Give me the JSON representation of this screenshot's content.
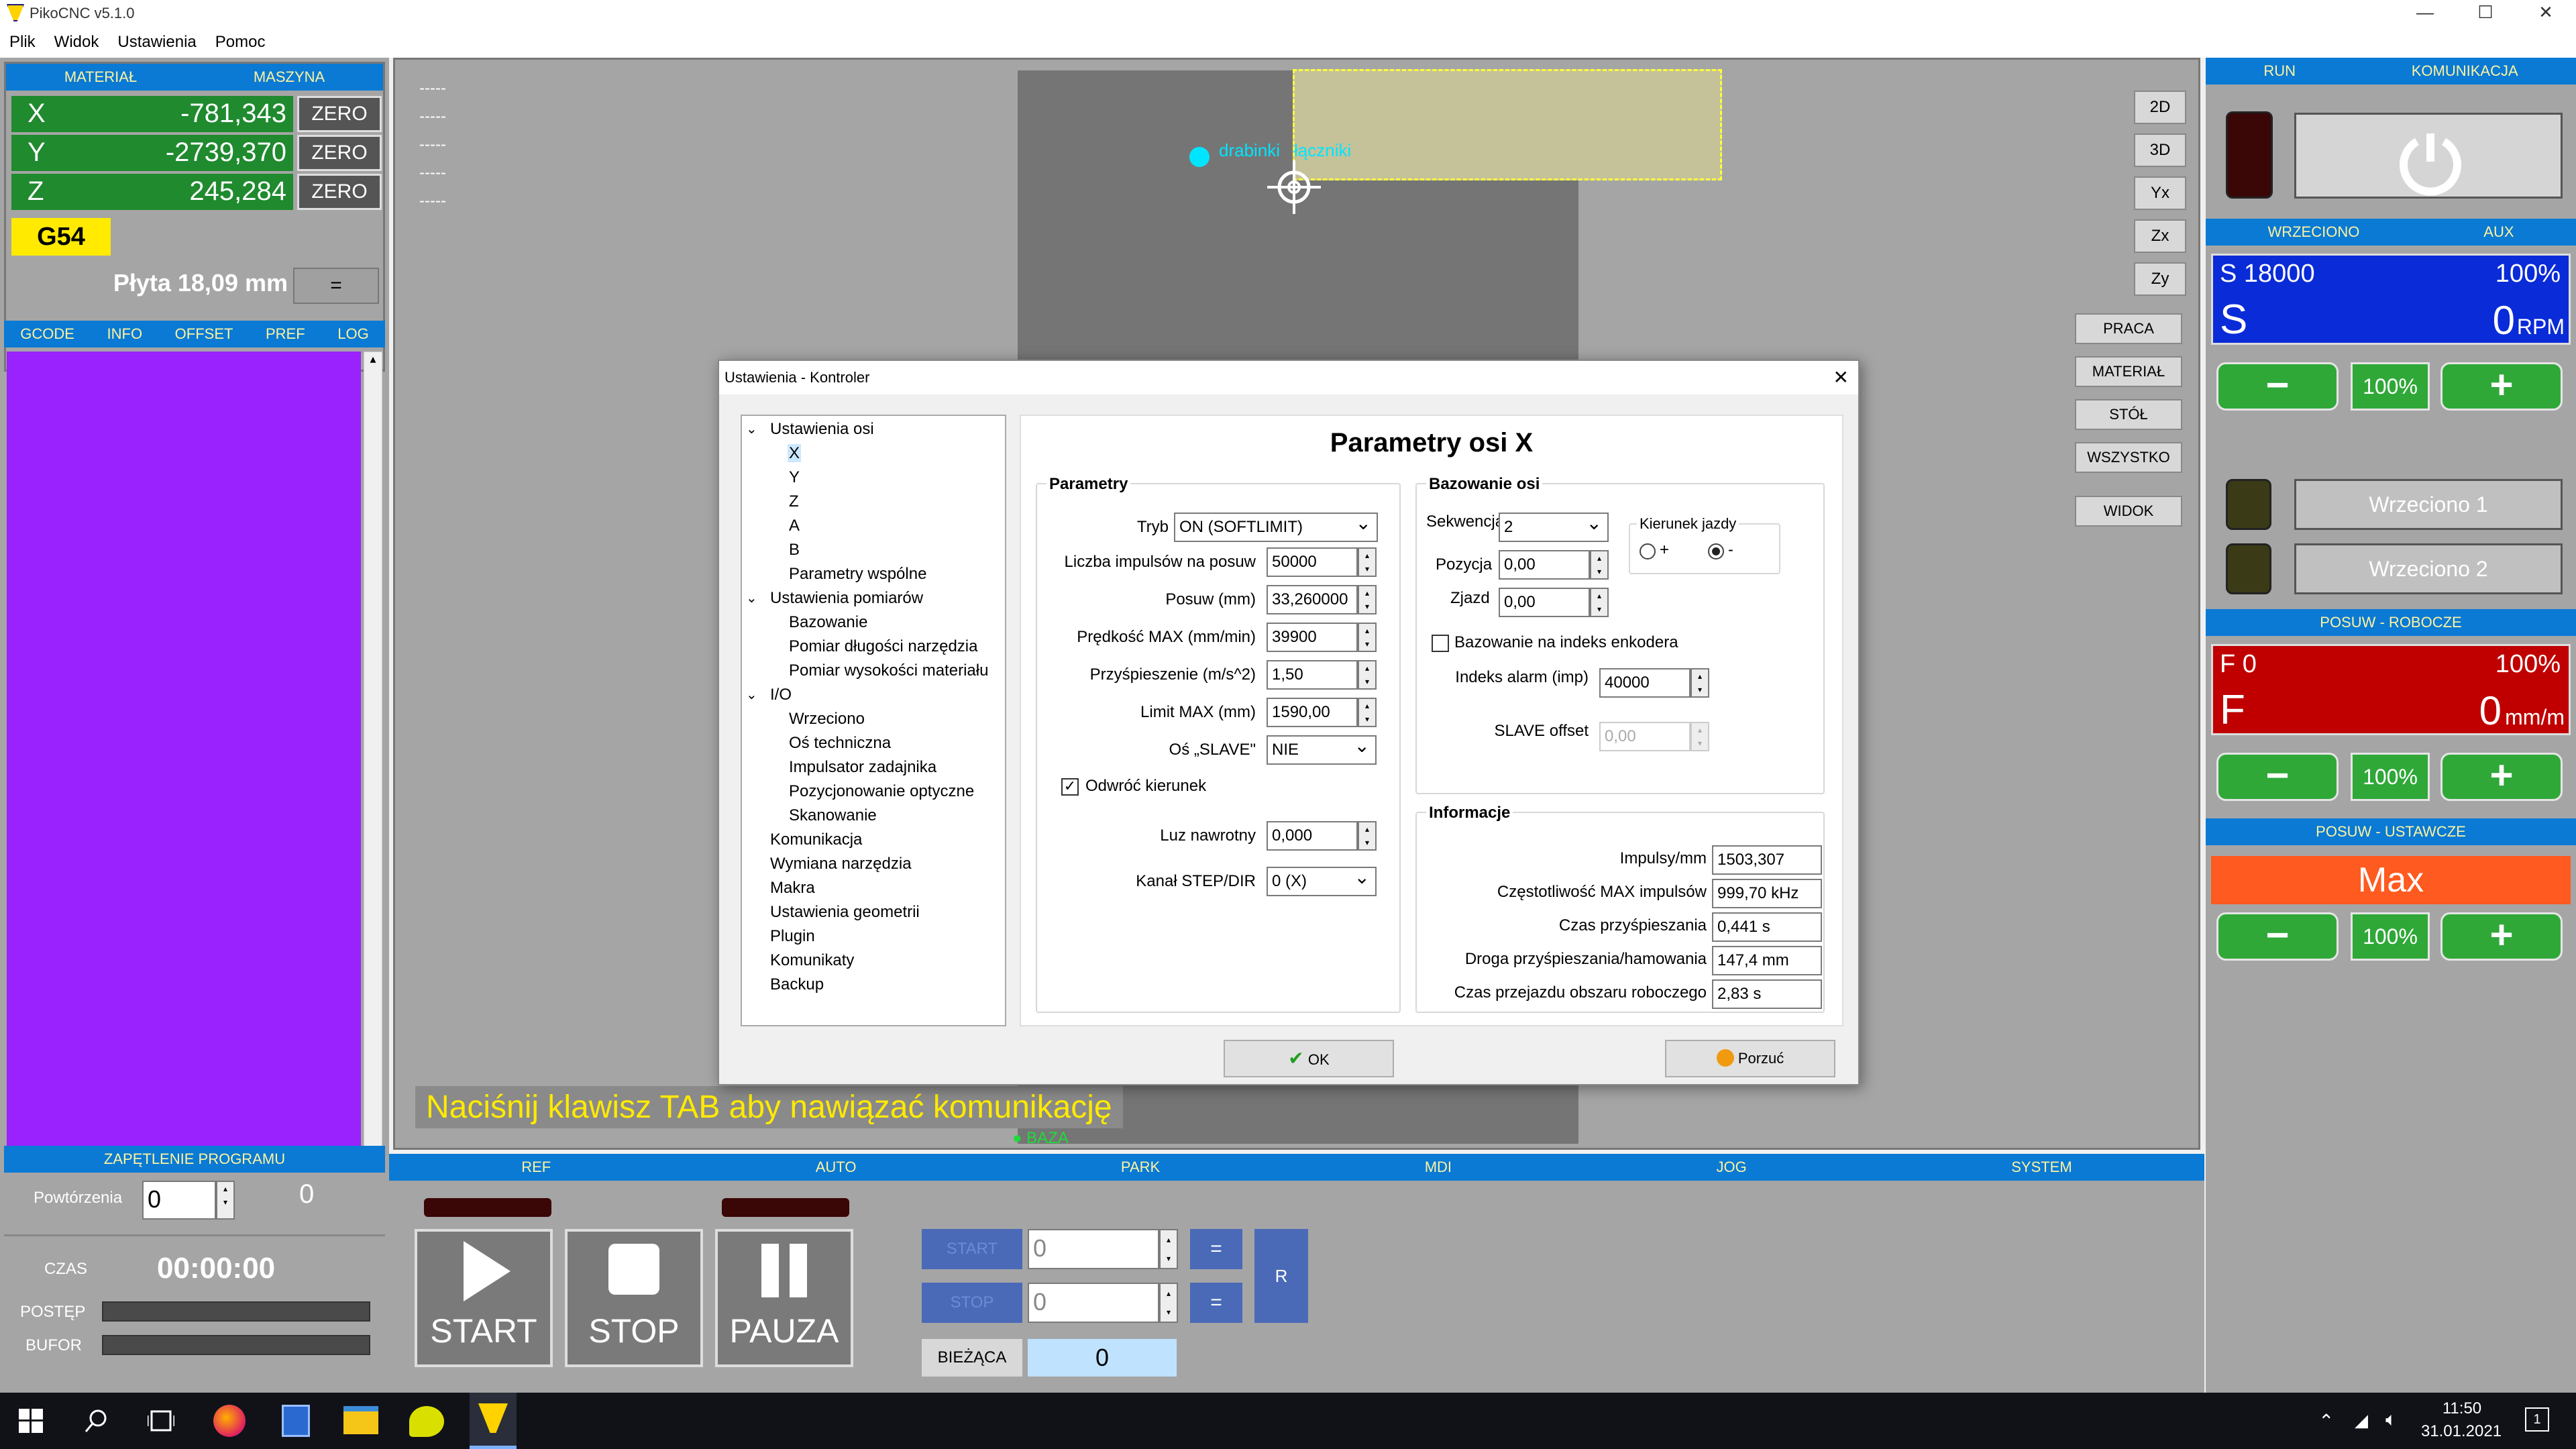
{
  "window": {
    "title": "PikoCNC v5.1.0",
    "minimize": "—",
    "maximize": "☐",
    "close": "✕"
  },
  "menu": [
    "Plik",
    "Widok",
    "Ustawienia",
    "Pomoc"
  ],
  "coords": {
    "hdr_material": "MATERIAŁ",
    "hdr_machine": "MASZYNA",
    "axes": [
      {
        "axis": "X",
        "value": "-781,343"
      },
      {
        "axis": "Y",
        "value": "-2739,370"
      },
      {
        "axis": "Z",
        "value": "245,284"
      }
    ],
    "zero_label": "ZERO",
    "workoffset": "G54",
    "plate": "Płyta 18,09 mm",
    "plate_btn": "="
  },
  "leftTabs": [
    "GCODE",
    "INFO",
    "OFFSET",
    "PREF",
    "LOG"
  ],
  "loop": {
    "header": "ZAPĘTLENIE PROGRAMU",
    "repeats_label": "Powtórzenia",
    "repeats_value": "0",
    "count": "0",
    "time_label": "CZAS",
    "time": "00:00:00",
    "progress_label": "POSTĘP",
    "buffer_label": "BUFOR",
    "progress": 0,
    "buffer": 0
  },
  "view": {
    "dashes": [
      "-----",
      "-----",
      "-----",
      "-----",
      "-----"
    ],
    "labels": [
      "drabinki",
      "łączniki"
    ],
    "view_buttons": [
      "2D",
      "3D",
      "Yx",
      "Zx",
      "Zy"
    ],
    "side_buttons": [
      "PRACA",
      "MATERIAŁ",
      "STÓŁ",
      "WSZYSTKO",
      "WIDOK"
    ],
    "message": "Naciśnij klawisz TAB aby nawiązać komunikację",
    "base_label": "BAZA"
  },
  "right": {
    "hdr_run": "RUN",
    "hdr_comm": "KOMUNIKACJA",
    "hdr_spindle": "WRZECIONO",
    "hdr_aux": "AUX",
    "spindle_set": "S 18000",
    "spindle_pct": "100%",
    "spindle_letter": "S",
    "spindle_rpm": "0",
    "spindle_unit": "RPM",
    "pct": "100%",
    "minus": "−",
    "plus": "+",
    "spindle1": "Wrzeciono 1",
    "spindle2": "Wrzeciono 2",
    "hdr_feed": "POSUW - ROBOCZE",
    "feed_set": "F 0",
    "feed_pct": "100%",
    "feed_letter": "F",
    "feed_val": "0",
    "feed_unit": "mm/m",
    "hdr_rapid": "POSUW - USTAWCZE",
    "rapid": "Max"
  },
  "bottom": {
    "tabs": [
      "REF",
      "AUTO",
      "PARK",
      "MDI",
      "JOG",
      "SYSTEM"
    ],
    "start": "START",
    "stop": "STOP",
    "pause": "PAUZA",
    "line_start": "START",
    "line_stop": "STOP",
    "line_start_val": "0",
    "line_stop_val": "0",
    "eq": "=",
    "r": "R",
    "current": "BIEŻĄCA",
    "current_val": "0"
  },
  "dialog": {
    "title": "Ustawienia - Kontroler",
    "heading": "Parametry osi X",
    "tree": [
      {
        "t": "Ustawienia osi",
        "lvl": 0,
        "exp": true
      },
      {
        "t": "X",
        "lvl": 1,
        "sel": true
      },
      {
        "t": "Y",
        "lvl": 1
      },
      {
        "t": "Z",
        "lvl": 1
      },
      {
        "t": "A",
        "lvl": 1
      },
      {
        "t": "B",
        "lvl": 1
      },
      {
        "t": "Parametry wspólne",
        "lvl": 1
      },
      {
        "t": "Ustawienia pomiarów",
        "lvl": 0,
        "exp": true
      },
      {
        "t": "Bazowanie",
        "lvl": 1
      },
      {
        "t": "Pomiar długości narzędzia",
        "lvl": 1
      },
      {
        "t": "Pomiar wysokości materiału",
        "lvl": 1
      },
      {
        "t": "I/O",
        "lvl": 0,
        "exp": true
      },
      {
        "t": "Wrzeciono",
        "lvl": 1
      },
      {
        "t": "Oś techniczna",
        "lvl": 1
      },
      {
        "t": "Impulsator zadajnika",
        "lvl": 1
      },
      {
        "t": "Pozycjonowanie optyczne",
        "lvl": 1
      },
      {
        "t": "Skanowanie",
        "lvl": 1
      },
      {
        "t": "Komunikacja",
        "lvl": 0
      },
      {
        "t": "Wymiana narzędzia",
        "lvl": 0
      },
      {
        "t": "Makra",
        "lvl": 0
      },
      {
        "t": "Ustawienia geometrii",
        "lvl": 0
      },
      {
        "t": "Plugin",
        "lvl": 0
      },
      {
        "t": "Komunikaty",
        "lvl": 0
      },
      {
        "t": "Backup",
        "lvl": 0
      }
    ],
    "params": {
      "title": "Parametry",
      "mode_label": "Tryb",
      "mode": "ON (SOFTLIMIT)",
      "pulses_label": "Liczba impulsów na posuw",
      "pulses": "50000",
      "feed_label": "Posuw (mm)",
      "feed": "33,260000",
      "vmax_label": "Prędkość MAX (mm/min)",
      "vmax": "39900",
      "acc_label": "Przyśpieszenie (m/s^2)",
      "acc": "1,50",
      "lim_label": "Limit MAX (mm)",
      "lim": "1590,00",
      "slave_label": "Oś „SLAVE\"",
      "slave": "NIE",
      "reverse_label": "Odwróć kierunek",
      "backlash_label": "Luz nawrotny",
      "backlash": "0,000",
      "chan_label": "Kanał STEP/DIR",
      "chan": "0 (X)"
    },
    "homing": {
      "title": "Bazowanie osi",
      "seq_label": "Sekwencja",
      "seq": "2",
      "pos_label": "Pozycja",
      "pos": "0,00",
      "exit_label": "Zjazd",
      "exit": "0,00",
      "dir_title": "Kierunek jazdy",
      "dir_plus": "+",
      "dir_minus": "-",
      "index_label": "Bazowanie na indeks enkodera",
      "alarm_label": "Indeks alarm (imp)",
      "alarm": "40000",
      "slave_off_label": "SLAVE offset",
      "slave_off": "0,00"
    },
    "info": {
      "title": "Informacje",
      "rows": [
        {
          "k": "Impulsy/mm",
          "v": "1503,307"
        },
        {
          "k": "Częstotliwość MAX impulsów",
          "v": "999,70 kHz"
        },
        {
          "k": "Czas przyśpieszania",
          "v": "0,441 s"
        },
        {
          "k": "Droga przyśpieszania/hamowania",
          "v": "147,4 mm"
        },
        {
          "k": "Czas przejazdu obszaru roboczego",
          "v": "2,83 s"
        }
      ]
    },
    "ok": "OK",
    "cancel": "Porzuć"
  },
  "taskbar": {
    "time": "11:50",
    "date": "31.01.2021",
    "notif": "1"
  },
  "colors": {
    "blue": "#0a7ad4",
    "green": "#1f8a2e",
    "purple": "#9a22ff",
    "yellow": "#ffea00",
    "red": "#c00000",
    "orange": "#ff5a1f"
  }
}
